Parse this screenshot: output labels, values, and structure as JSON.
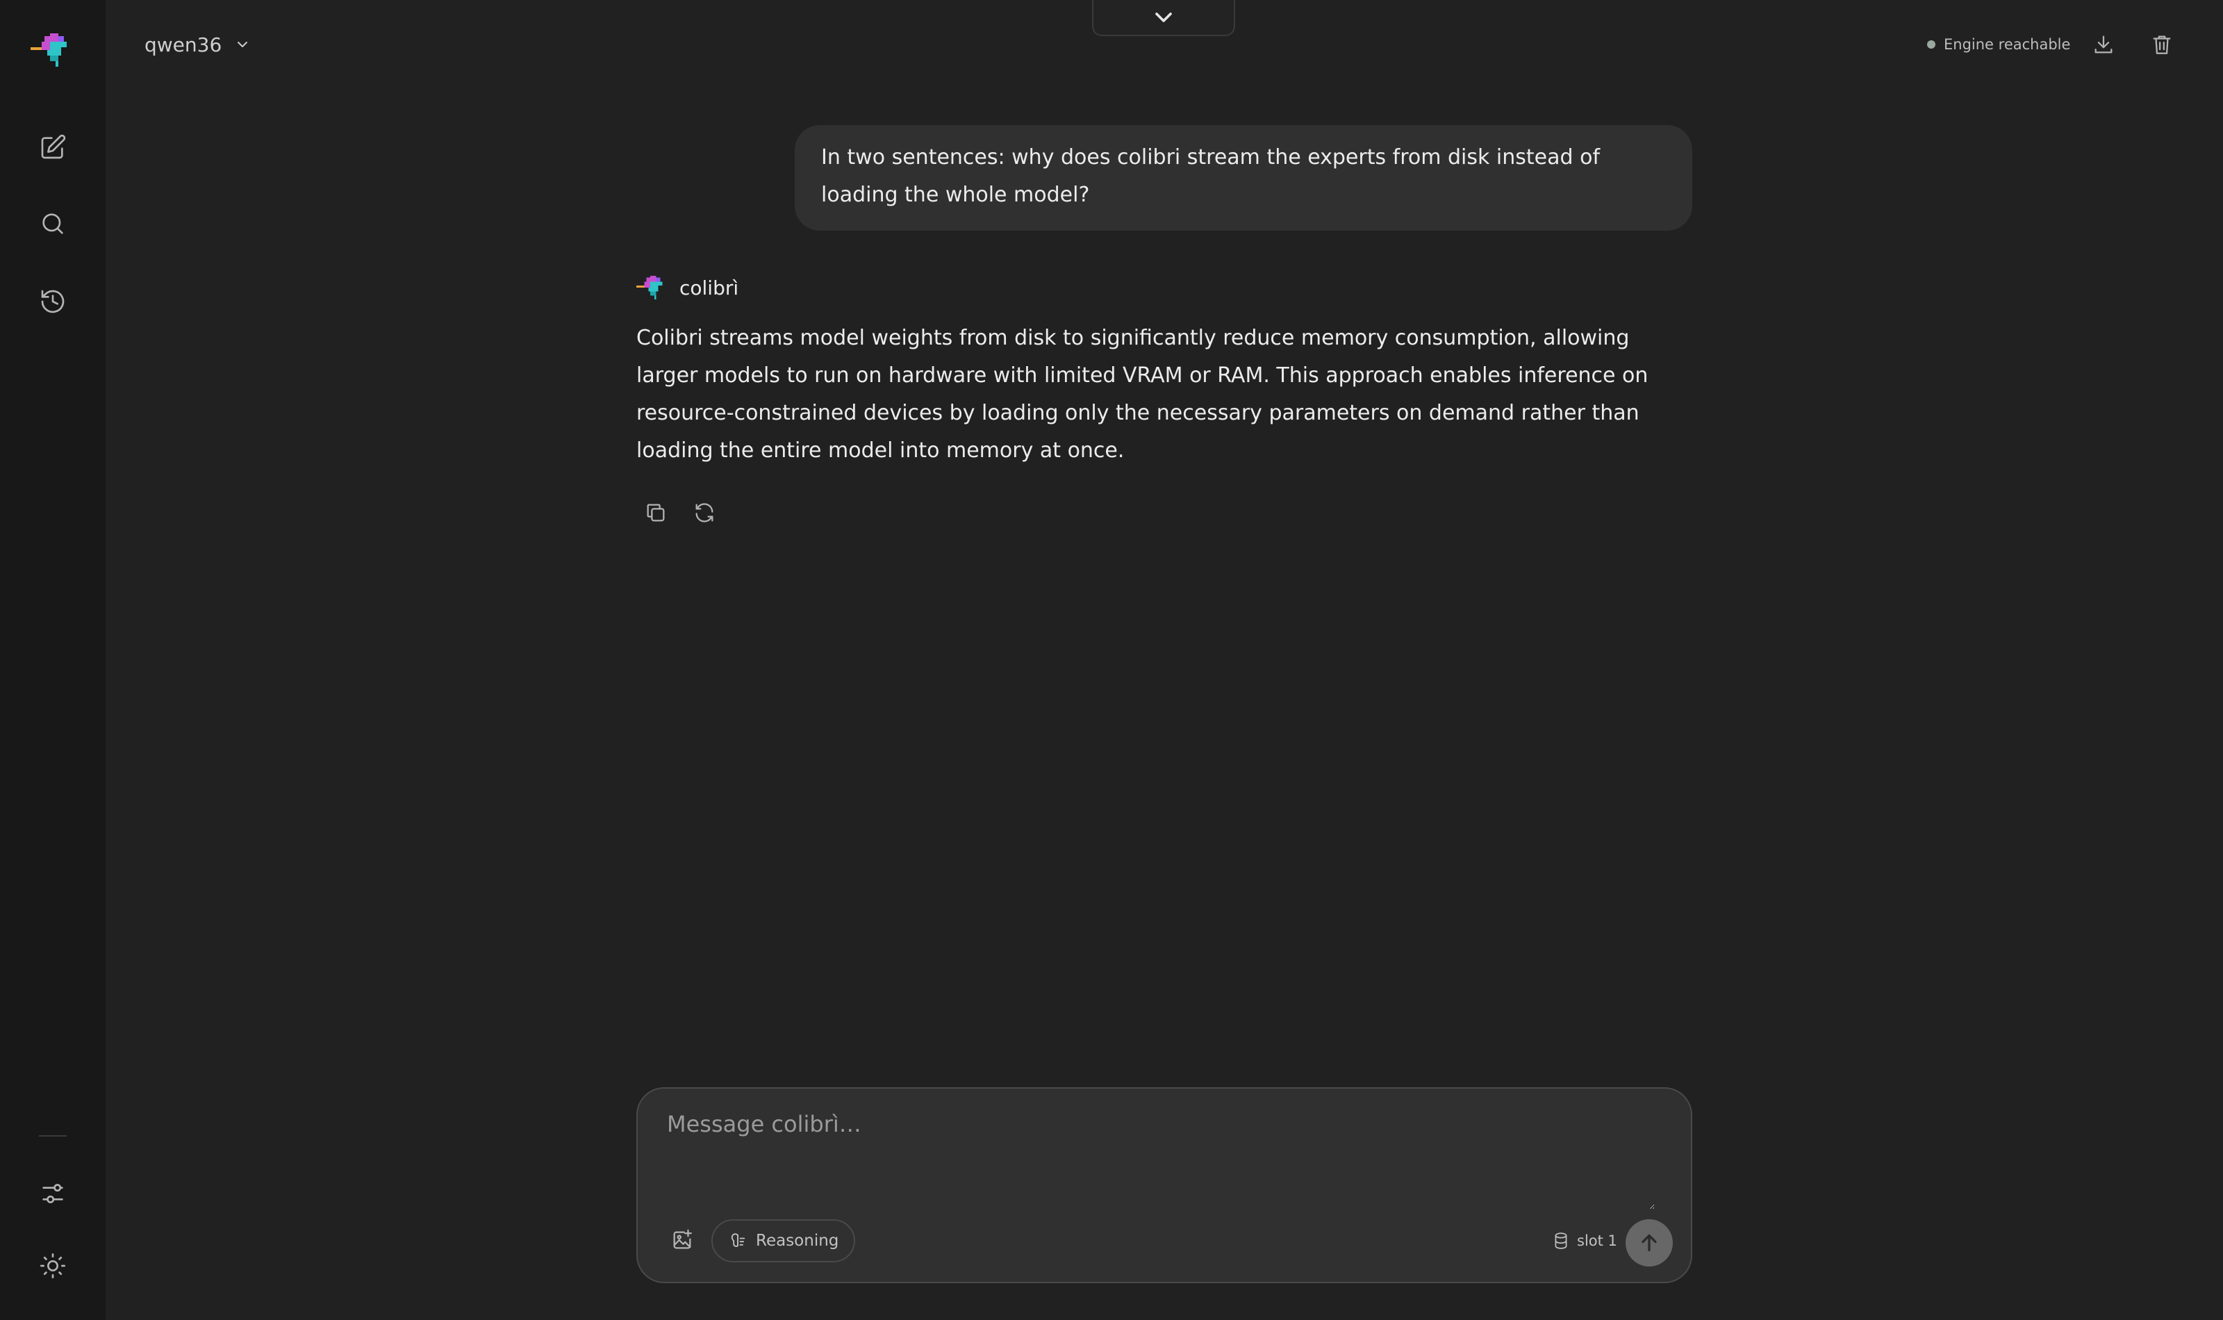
{
  "topbar": {
    "model_name": "qwen36"
  },
  "status": {
    "text": "Engine reachable",
    "dot_color": "#9aa8a0"
  },
  "conversation": {
    "user_message": "In two sentences: why does colibri stream the experts from disk instead of loading the whole model?",
    "assistant_name": "colibrì",
    "assistant_message": "Colibri streams model weights from disk to significantly reduce memory consumption, allowing larger models to run on hardware with limited VRAM or RAM. This approach enables inference on resource-constrained devices by loading only the necessary parameters on demand rather than loading the entire model into memory at once."
  },
  "composer": {
    "placeholder": "Message colibrì…",
    "reasoning_label": "Reasoning",
    "slot_label": "slot 1"
  },
  "colors": {
    "background": "#212121",
    "sidebar": "#181818",
    "bubble": "#303030",
    "accent_magenta": "#c64fd0",
    "accent_cyan": "#2ec4c8",
    "accent_orange": "#e8a23a"
  },
  "icons": {
    "sidebar": [
      "new-chat-icon",
      "search-icon",
      "history-icon",
      "settings-sliders-icon",
      "theme-sun-icon"
    ],
    "top": [
      "chevron-down-icon",
      "download-icon",
      "trash-icon"
    ],
    "message_actions": [
      "copy-icon",
      "regenerate-icon"
    ],
    "composer": [
      "image-attach-icon",
      "reasoning-icon",
      "database-icon",
      "send-arrow-icon"
    ]
  }
}
